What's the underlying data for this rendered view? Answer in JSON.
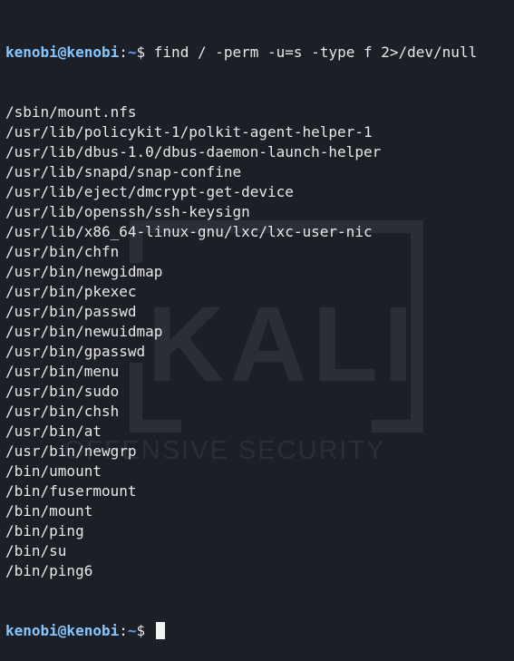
{
  "prompt": {
    "user_host": "kenobi@kenobi",
    "separator": ":",
    "path": "~",
    "dollar": "$"
  },
  "command": " find / -perm -u=s -type f 2>/dev/null",
  "output": [
    "/sbin/mount.nfs",
    "/usr/lib/policykit-1/polkit-agent-helper-1",
    "/usr/lib/dbus-1.0/dbus-daemon-launch-helper",
    "/usr/lib/snapd/snap-confine",
    "/usr/lib/eject/dmcrypt-get-device",
    "/usr/lib/openssh/ssh-keysign",
    "/usr/lib/x86_64-linux-gnu/lxc/lxc-user-nic",
    "/usr/bin/chfn",
    "/usr/bin/newgidmap",
    "/usr/bin/pkexec",
    "/usr/bin/passwd",
    "/usr/bin/newuidmap",
    "/usr/bin/gpasswd",
    "/usr/bin/menu",
    "/usr/bin/sudo",
    "/usr/bin/chsh",
    "/usr/bin/at",
    "/usr/bin/newgrp",
    "/bin/umount",
    "/bin/fusermount",
    "/bin/mount",
    "/bin/ping",
    "/bin/su",
    "/bin/ping6"
  ],
  "watermark": {
    "logo_text": "KALI",
    "tagline": "OFFENSIVE SECURITY"
  },
  "colors": {
    "background": "#1c1f26",
    "prompt_user": "#86c7ff",
    "prompt_path": "#5aa0ff",
    "text": "#e8e8e8"
  }
}
